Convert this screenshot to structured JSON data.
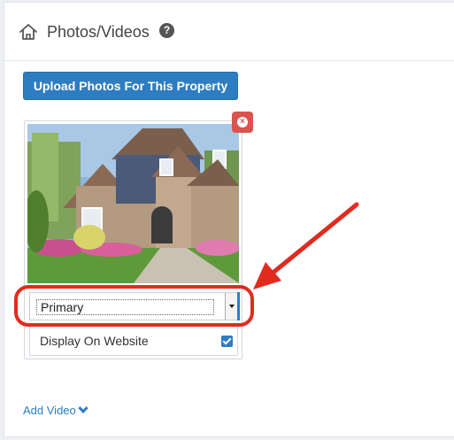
{
  "header": {
    "title": "Photos/Videos",
    "help_glyph": "?"
  },
  "upload_button": {
    "label": "Upload Photos For This Property"
  },
  "photo_card": {
    "photo_alt": "house photo",
    "remove_glyph": "×",
    "type_select": {
      "selected": "Primary"
    },
    "display_on_website": {
      "label": "Display On Website",
      "checked": true
    }
  },
  "add_video": {
    "label": "Add Video"
  },
  "colors": {
    "accent": "#2e7dc2",
    "danger": "#d9534f",
    "annotation": "#e22b1f"
  }
}
